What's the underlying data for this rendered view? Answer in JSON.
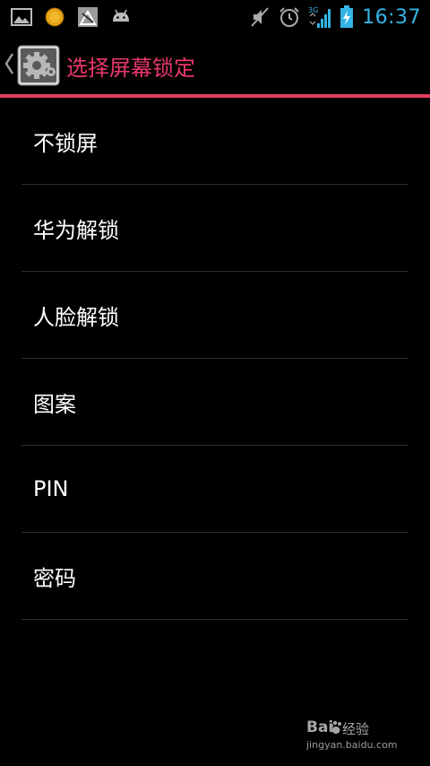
{
  "status_bar": {
    "left_icons": [
      "picture-icon",
      "weather-sun-icon",
      "signal-app-icon",
      "android-icon"
    ],
    "right_icons": [
      "mute-icon",
      "alarm-icon",
      "network-3g-icon",
      "battery-charging-icon"
    ],
    "network_label": "3G",
    "time": "16:37",
    "time_color": "#33b5e5"
  },
  "action_bar": {
    "title": "选择屏幕锁定",
    "title_color": "#e8386a",
    "divider_color": "#e23d5f"
  },
  "list": {
    "items": [
      {
        "label": "不锁屏"
      },
      {
        "label": "华为解锁"
      },
      {
        "label": "人脸解锁"
      },
      {
        "label": "图案"
      },
      {
        "label": "PIN"
      },
      {
        "label": "密码"
      }
    ]
  },
  "watermark": {
    "brand": "经验",
    "url": "jingyan.baidu.com"
  }
}
